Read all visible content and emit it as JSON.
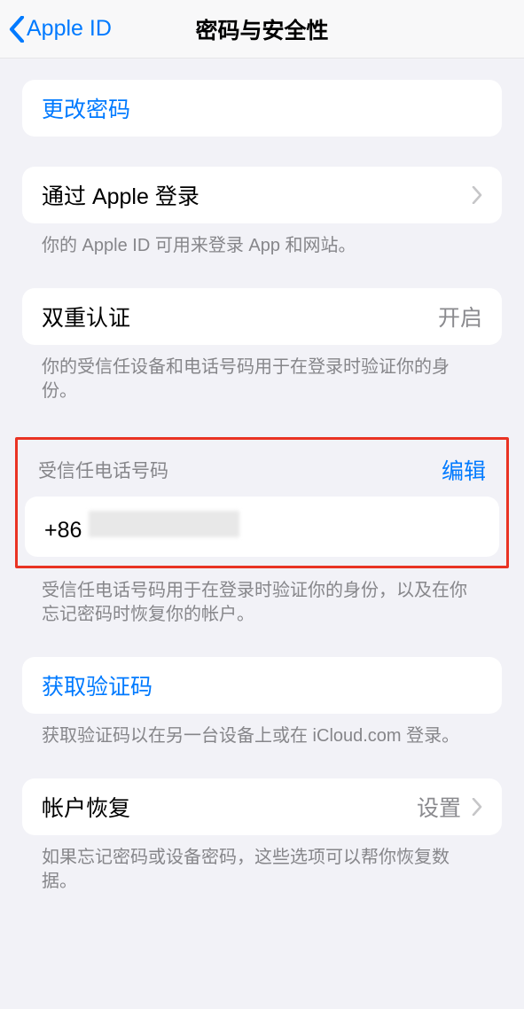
{
  "nav": {
    "back_label": "Apple ID",
    "title": "密码与安全性"
  },
  "change_password": {
    "label": "更改密码"
  },
  "sign_in_apple": {
    "label": "通过 Apple 登录",
    "footer": "你的 Apple ID 可用来登录 App 和网站。"
  },
  "two_factor": {
    "label": "双重认证",
    "status": "开启",
    "footer": "你的受信任设备和电话号码用于在登录时验证你的身份。"
  },
  "trusted_phone": {
    "header": "受信任电话号码",
    "edit": "编辑",
    "prefix": "+86",
    "footer": "受信任电话号码用于在登录时验证你的身份，以及在你忘记密码时恢复你的帐户。"
  },
  "get_code": {
    "label": "获取验证码",
    "footer": "获取验证码以在另一台设备上或在 iCloud.com 登录。"
  },
  "account_recovery": {
    "label": "帐户恢复",
    "detail": "设置",
    "footer": "如果忘记密码或设备密码，这些选项可以帮你恢复数据。"
  }
}
